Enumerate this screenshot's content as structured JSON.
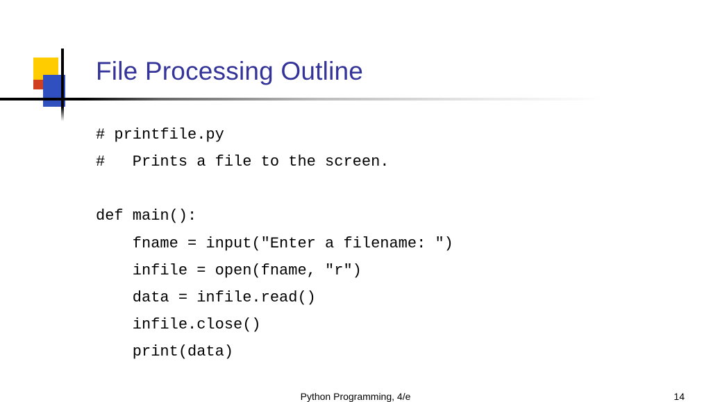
{
  "title": "File Processing Outline",
  "code": "# printfile.py\n#   Prints a file to the screen.\n\ndef main():\n    fname = input(\"Enter a filename: \")\n    infile = open(fname, \"r\")\n    data = infile.read()\n    infile.close()\n    print(data)",
  "footer": {
    "center": "Python Programming, 4/e",
    "page": "14"
  }
}
